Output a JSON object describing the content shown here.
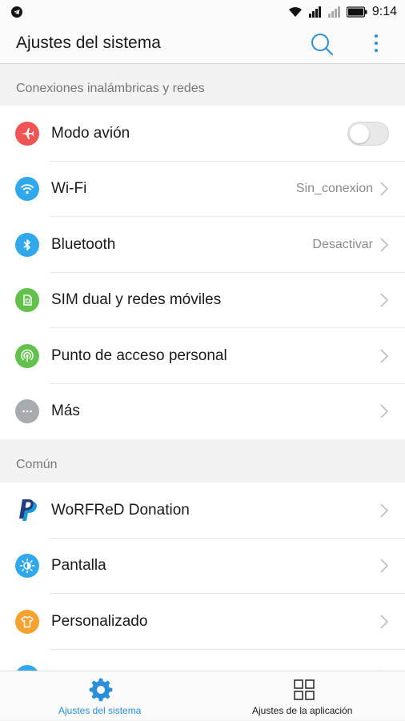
{
  "status_bar": {
    "time": "9:14",
    "icons": [
      "telegram-icon",
      "wifi-icon",
      "signal-icon",
      "signal-icon",
      "battery-icon"
    ]
  },
  "app_bar": {
    "title": "Ajustes del sistema",
    "icons": [
      "search-icon",
      "more-vert-icon"
    ]
  },
  "sections": [
    {
      "title": "Conexiones inalámbricas y redes",
      "items": [
        {
          "label": "Modo avión",
          "value": "",
          "icon": "airplane-icon",
          "color": "#f05454",
          "toggle": true,
          "toggle_on": false
        },
        {
          "label": "Wi-Fi",
          "value": "Sin_conexion",
          "icon": "wifi-icon",
          "color": "#32a8ec"
        },
        {
          "label": "Bluetooth",
          "value": "Desactivar",
          "icon": "bluetooth-icon",
          "color": "#32a8ec"
        },
        {
          "label": "SIM dual y redes móviles",
          "value": "",
          "icon": "sim-icon",
          "color": "#62c14b"
        },
        {
          "label": "Punto de acceso personal",
          "value": "",
          "icon": "hotspot-icon",
          "color": "#62c14b"
        },
        {
          "label": "Más",
          "value": "",
          "icon": "more-horiz-icon",
          "color": "#a7aaaf"
        }
      ]
    },
    {
      "title": "Común",
      "items": [
        {
          "label": "WoRFReD Donation",
          "value": "",
          "icon": "paypal-icon",
          "color": "#253b80"
        },
        {
          "label": "Pantalla",
          "value": "",
          "icon": "brightness-icon",
          "color": "#32a8ec"
        },
        {
          "label": "Personalizado",
          "value": "",
          "icon": "shirt-icon",
          "color": "#f5a231"
        }
      ]
    }
  ],
  "bottom_nav": {
    "items": [
      {
        "label": "Ajustes del sistema",
        "icon": "gear-icon",
        "active": true
      },
      {
        "label": "Ajustes de la aplicación",
        "icon": "grid-icon",
        "active": false
      }
    ]
  },
  "colors": {
    "accent": "#2a8fd8",
    "background": "#f2f2f2",
    "card": "#ffffff"
  }
}
